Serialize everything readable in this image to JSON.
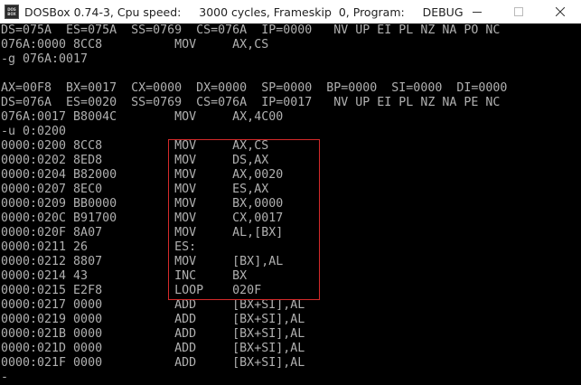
{
  "window": {
    "title": "DOSBox 0.74-3, Cpu speed:     3000 cycles, Frameskip  0, Program:     DEBUG",
    "icon_label_top": "DOS",
    "icon_label_bottom": "BOX",
    "icons": {
      "minimize": "minimize-icon",
      "maximize": "maximize-icon",
      "close": "close-icon"
    }
  },
  "console": {
    "text_color": "#b0b0b0",
    "background": "#000000",
    "highlight_color": "#d42a2a",
    "lines": [
      "DS=075A  ES=075A  SS=0769  CS=076A  IP=0000   NV UP EI PL NZ NA PO NC",
      "076A:0000 8CC8          MOV     AX,CS",
      "-g 076A:0017",
      "",
      "AX=00F8  BX=0017  CX=0000  DX=0000  SP=0000  BP=0000  SI=0000  DI=0000",
      "DS=076A  ES=0020  SS=0769  CS=076A  IP=0017   NV UP EI PL NZ NA PE NC",
      "076A:0017 B8004C        MOV     AX,4C00",
      "-u 0:0200",
      "0000:0200 8CC8          MOV     AX,CS",
      "0000:0202 8ED8          MOV     DS,AX",
      "0000:0204 B82000        MOV     AX,0020",
      "0000:0207 8EC0          MOV     ES,AX",
      "0000:0209 BB0000        MOV     BX,0000",
      "0000:020C B91700        MOV     CX,0017",
      "0000:020F 8A07          MOV     AL,[BX]",
      "0000:0211 26            ES:",
      "0000:0212 8807          MOV     [BX],AL",
      "0000:0214 43            INC     BX",
      "0000:0215 E2F8          LOOP    020F",
      "0000:0217 0000          ADD     [BX+SI],AL",
      "0000:0219 0000          ADD     [BX+SI],AL",
      "0000:021B 0000          ADD     [BX+SI],AL",
      "0000:021D 0000          ADD     [BX+SI],AL",
      "0000:021F 0000          ADD     [BX+SI],AL",
      "-"
    ]
  }
}
